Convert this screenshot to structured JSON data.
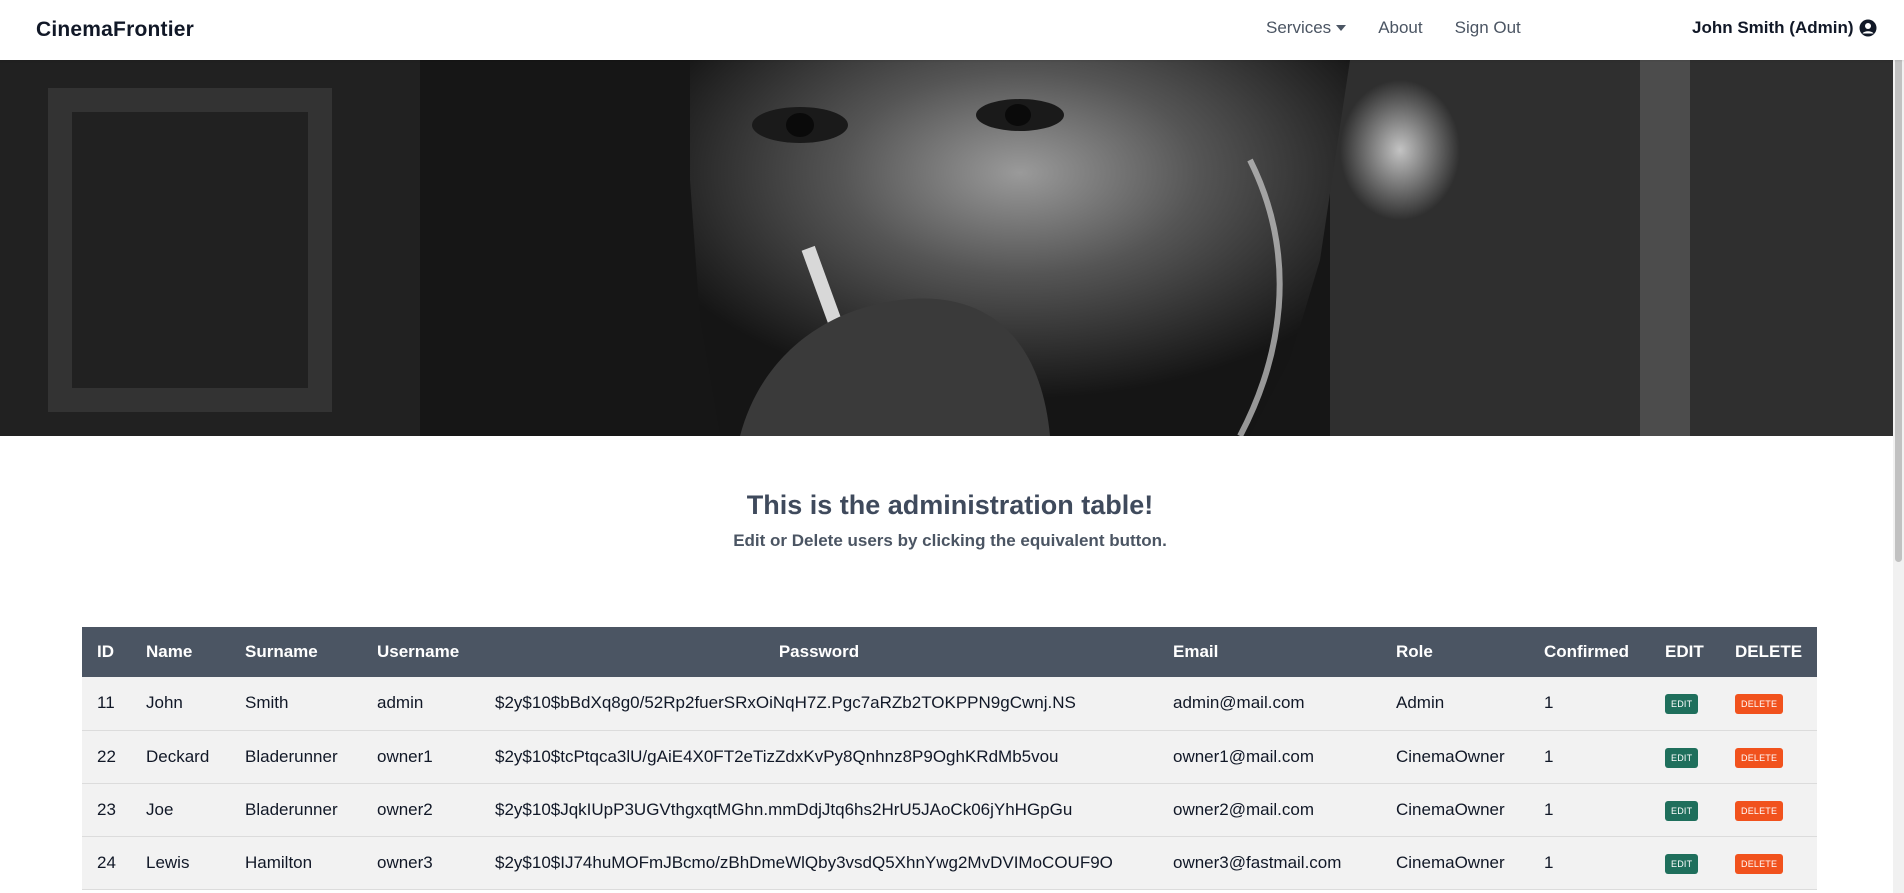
{
  "navbar": {
    "brand": "CinemaFrontier",
    "links": {
      "services": "Services",
      "about": "About",
      "signout": "Sign Out"
    },
    "user": "John Smith (Admin)"
  },
  "intro": {
    "title": "This is the administration table!",
    "subtitle": "Edit or Delete users by clicking the equivalent button."
  },
  "table": {
    "headers": [
      "ID",
      "Name",
      "Surname",
      "Username",
      "Password",
      "Email",
      "Role",
      "Confirmed",
      "EDIT",
      "DELETE"
    ],
    "edit_label": "EDIT",
    "delete_label": "DELETE",
    "rows": [
      [
        "11",
        "John",
        "Smith",
        "admin",
        "$2y$10$bBdXq8g0/52Rp2fuerSRxOiNqH7Z.Pgc7aRZb2TOKPPN9gCwnj.NS",
        "admin@mail.com",
        "Admin",
        "1"
      ],
      [
        "22",
        "Deckard",
        "Bladerunner",
        "owner1",
        "$2y$10$tcPtqca3lU/gAiE4X0FT2eTizZdxKvPy8Qnhnz8P9OghKRdMb5vou",
        "owner1@mail.com",
        "CinemaOwner",
        "1"
      ],
      [
        "23",
        "Joe",
        "Bladerunner",
        "owner2",
        "$2y$10$JqkIUpP3UGVthgxqtMGhn.mmDdjJtq6hs2HrU5JAoCk06jYhHGpGu",
        "owner2@mail.com",
        "CinemaOwner",
        "1"
      ],
      [
        "24",
        "Lewis",
        "Hamilton",
        "owner3",
        "$2y$10$IJ74huMOFmJBcmo/zBhDmeWlQby3vsdQ5XhnYwg2MvDVIMoCOUF9O",
        "owner3@fastmail.com",
        "CinemaOwner",
        "1"
      ]
    ]
  },
  "colors": {
    "header_bg": "#4b5563",
    "edit_button": "#1f6f5c",
    "delete_button": "#f1521d"
  }
}
